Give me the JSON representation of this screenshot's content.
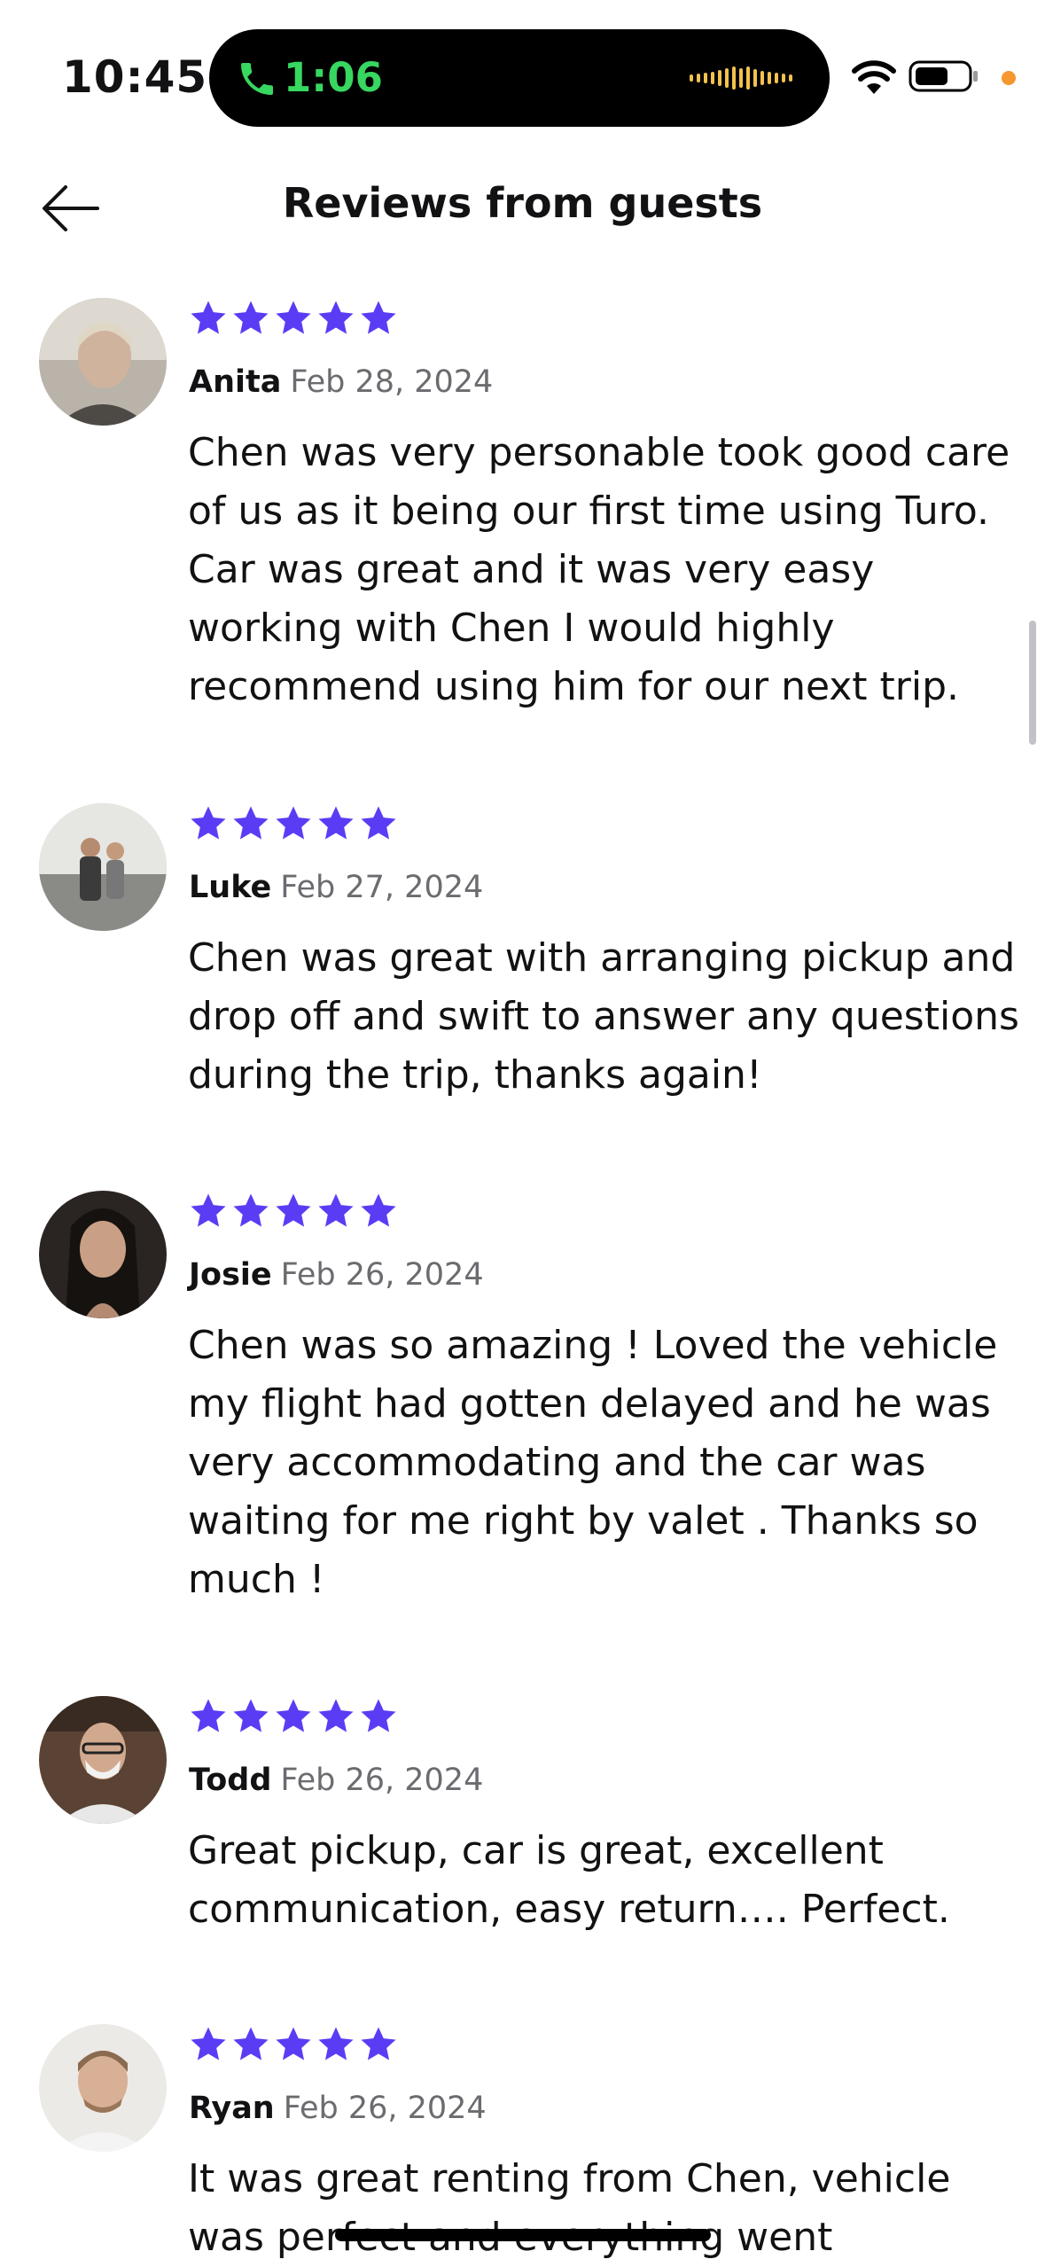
{
  "status_bar": {
    "time": "10:45",
    "call_duration": "1:06",
    "icons": [
      "phone-icon",
      "waveform-icon",
      "wifi-icon",
      "battery-icon"
    ],
    "call_color": "#37d760",
    "indicator_color": "#f5972e"
  },
  "header": {
    "title": "Reviews from guests",
    "back_icon": "arrow-left-icon"
  },
  "accent_color": "#5b3cf5",
  "reviews": [
    {
      "name": "Anita",
      "date": "Feb 28, 2024",
      "rating": 5,
      "text": "Chen was very personable took good care of us as it being our first time using Turo. Car was great and it was very easy working with Chen I would highly recommend using him for our next trip."
    },
    {
      "name": "Luke",
      "date": "Feb 27, 2024",
      "rating": 5,
      "text": "Chen was great with arranging pickup and drop off and swift to answer any questions during the trip, thanks again!"
    },
    {
      "name": "Josie",
      "date": "Feb 26, 2024",
      "rating": 5,
      "text": "Chen was so amazing ! Loved the vehicle my flight had gotten delayed and he was very accommodating and the car was waiting for me right by valet . Thanks so much !"
    },
    {
      "name": "Todd",
      "date": "Feb 26, 2024",
      "rating": 5,
      "text": "Great pickup, car is great, excellent communication, easy return…. Perfect."
    },
    {
      "name": "Ryan",
      "date": "Feb 26, 2024",
      "rating": 5,
      "text": "It was great renting from Chen, vehicle was perfect and everything went"
    }
  ]
}
